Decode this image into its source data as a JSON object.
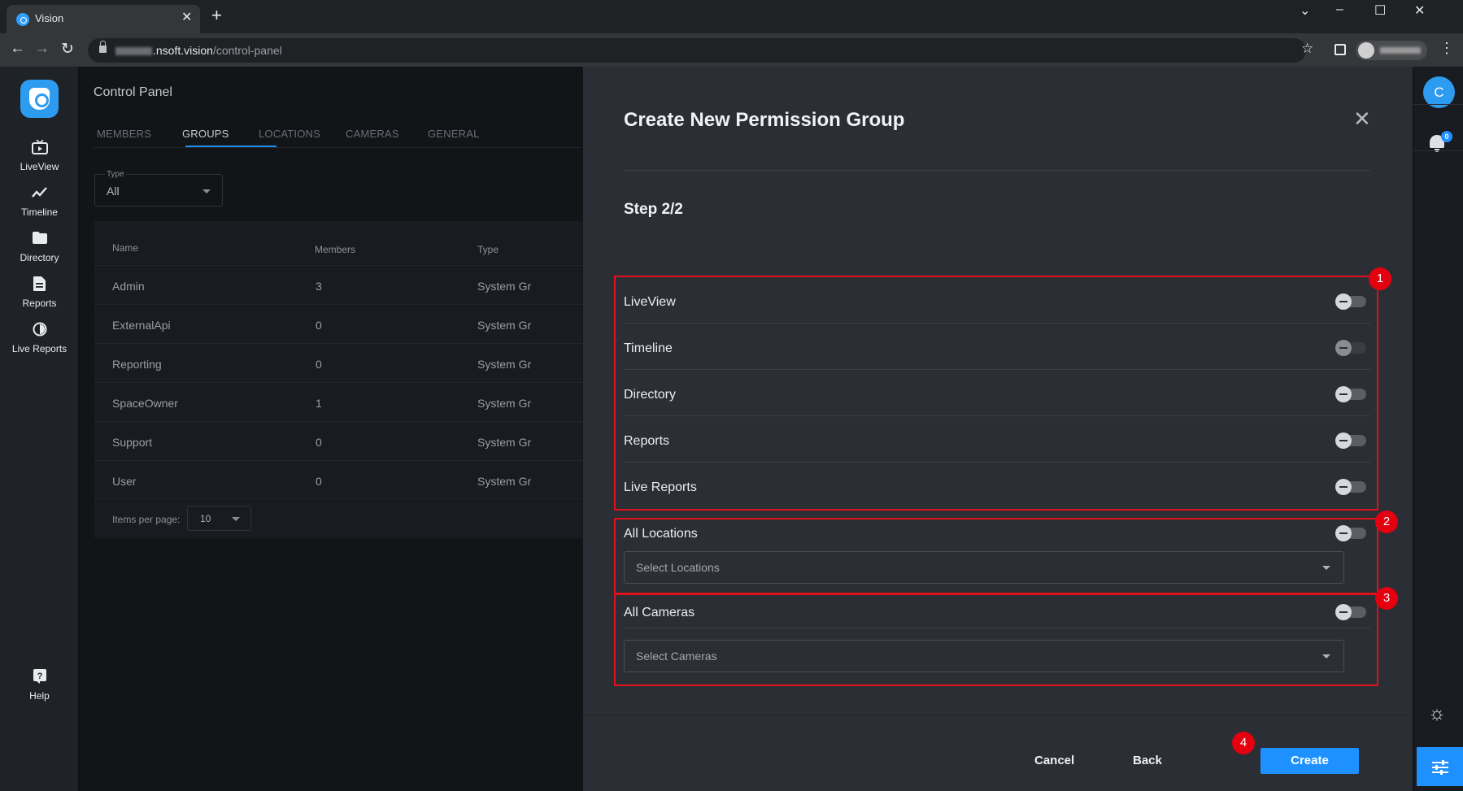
{
  "browser": {
    "tab_title": "Vision",
    "url_prefix": "",
    "url_host": ".nsoft.vision",
    "url_path": "/control-panel"
  },
  "left_nav": {
    "items": [
      {
        "label": "LiveView",
        "icon": "liveview-icon"
      },
      {
        "label": "Timeline",
        "icon": "timeline-icon"
      },
      {
        "label": "Directory",
        "icon": "folder-icon"
      },
      {
        "label": "Reports",
        "icon": "reports-icon"
      },
      {
        "label": "Live Reports",
        "icon": "live-reports-icon"
      }
    ],
    "help": {
      "label": "Help",
      "icon": "help-icon"
    }
  },
  "control_panel": {
    "title": "Control Panel",
    "tabs": [
      "MEMBERS",
      "GROUPS",
      "LOCATIONS",
      "CAMERAS",
      "GENERAL"
    ],
    "active_tab": "GROUPS",
    "type_filter": {
      "label": "Type",
      "value": "All"
    },
    "columns": [
      "Name",
      "Members",
      "Type"
    ],
    "rows": [
      {
        "name": "Admin",
        "members": "3",
        "type": "System Gr"
      },
      {
        "name": "ExternalApi",
        "members": "0",
        "type": "System Gr"
      },
      {
        "name": "Reporting",
        "members": "0",
        "type": "System Gr"
      },
      {
        "name": "SpaceOwner",
        "members": "1",
        "type": "System Gr"
      },
      {
        "name": "Support",
        "members": "0",
        "type": "System Gr"
      },
      {
        "name": "User",
        "members": "0",
        "type": "System Gr"
      }
    ],
    "items_per_page_label": "Items per page:",
    "items_per_page": "10"
  },
  "dialog": {
    "title": "Create New Permission Group",
    "step": "Step 2/2",
    "permissions": [
      {
        "label": "LiveView",
        "enabled": false
      },
      {
        "label": "Timeline",
        "enabled": false
      },
      {
        "label": "Directory",
        "enabled": false
      },
      {
        "label": "Reports",
        "enabled": false
      },
      {
        "label": "Live Reports",
        "enabled": false
      }
    ],
    "all_locations": {
      "label": "All Locations",
      "enabled": false,
      "placeholder": "Select Locations"
    },
    "all_cameras": {
      "label": "All Cameras",
      "enabled": false,
      "placeholder": "Select Cameras"
    },
    "buttons": {
      "cancel": "Cancel",
      "back": "Back",
      "create": "Create"
    },
    "annotations": [
      "1",
      "2",
      "3",
      "4"
    ]
  },
  "right_rail": {
    "avatar_initial": "C",
    "notification_count": "0"
  },
  "colors": {
    "accent": "#1e90ff",
    "annotation_red": "#e5000f",
    "dialog_bg": "#2b2e34",
    "page_bg": "#121418"
  }
}
